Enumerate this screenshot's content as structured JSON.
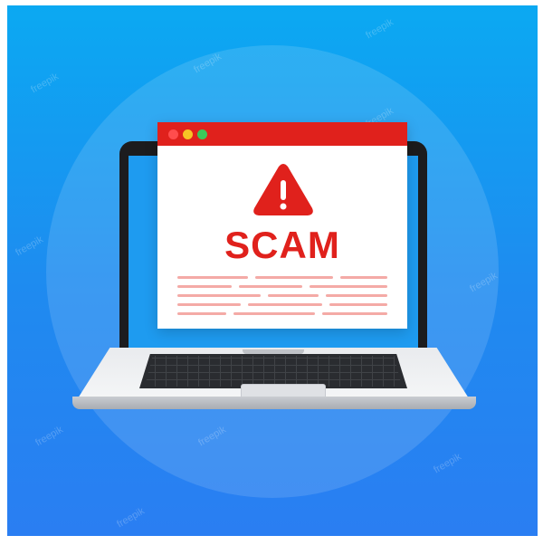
{
  "illustration": {
    "popup_title_text": "SCAM",
    "warning_icon": "exclamation-triangle-icon",
    "window_controls": [
      "close-dot",
      "minimize-dot",
      "maximize-dot"
    ],
    "colors": {
      "background_top": "#0ba9f2",
      "background_bottom": "#2a7ef2",
      "alert_red": "#e0211c",
      "laptop_bezel": "#1c1c1e",
      "laptop_body": "#e9ebee",
      "placeholder_lines": "#f4aaa6",
      "dot_red": "#ff4d4d",
      "dot_yellow": "#f7c325",
      "dot_green": "#3cc85a"
    },
    "watermark_text": "freepik"
  }
}
